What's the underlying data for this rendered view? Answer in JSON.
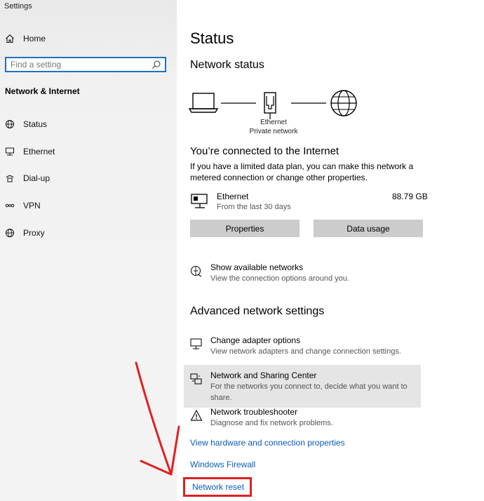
{
  "window": {
    "title": "Settings"
  },
  "sidebar": {
    "home_label": "Home",
    "search_placeholder": "Find a setting",
    "section_label": "Network & Internet",
    "items": [
      {
        "label": "Status",
        "icon": "globe-icon"
      },
      {
        "label": "Ethernet",
        "icon": "ethernet-icon"
      },
      {
        "label": "Dial-up",
        "icon": "dialup-icon"
      },
      {
        "label": "VPN",
        "icon": "vpn-icon"
      },
      {
        "label": "Proxy",
        "icon": "globe-icon"
      }
    ]
  },
  "main": {
    "title": "Status",
    "network_status_heading": "Network status",
    "diagram": {
      "adapter_label": "Ethernet",
      "network_label": "Private network"
    },
    "connected_heading": "You’re connected to the Internet",
    "connected_desc_line1": "If you have a limited data plan, you can make this network a",
    "connected_desc_line2": "metered connection or change other properties.",
    "connection": {
      "name": "Ethernet",
      "subtext": "From the last 30 days",
      "usage": "88.79 GB"
    },
    "buttons": {
      "properties": "Properties",
      "data_usage": "Data usage"
    },
    "show_networks": {
      "title": "Show available networks",
      "desc": "View the connection options around you."
    },
    "advanced_heading": "Advanced network settings",
    "advanced_items": [
      {
        "title": "Change adapter options",
        "desc": "View network adapters and change connection settings.",
        "icon": "adapter-icon"
      },
      {
        "title": "Network and Sharing Center",
        "desc": "For the networks you connect to, decide what you want to share.",
        "icon": "sharing-center-icon"
      },
      {
        "title": "Network troubleshooter",
        "desc": "Diagnose and fix network problems.",
        "icon": "warning-icon"
      }
    ],
    "links": {
      "hardware": "View hardware and connection properties",
      "firewall": "Windows Firewall",
      "reset": "Network reset"
    }
  },
  "annotation": {
    "color": "#e02020"
  },
  "colors": {
    "accent": "#1f70c1",
    "link": "#0a5cb8",
    "button": "#cccccc"
  }
}
